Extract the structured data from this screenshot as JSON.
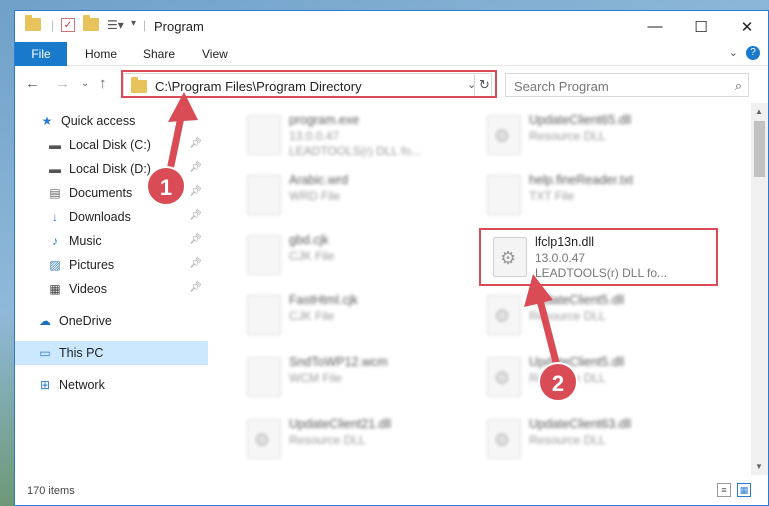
{
  "window": {
    "title": "Program"
  },
  "ribbon": {
    "tabs": [
      {
        "label": "File"
      },
      {
        "label": "Home"
      },
      {
        "label": "Share"
      },
      {
        "label": "View"
      }
    ]
  },
  "address": {
    "path": "C:\\Program Files\\Program Directory"
  },
  "search": {
    "placeholder": "Search Program"
  },
  "nav": {
    "items": [
      {
        "label": "Quick access",
        "icon": "star-icon"
      },
      {
        "label": "Local Disk (C:)",
        "icon": "drive-icon",
        "pinned": true
      },
      {
        "label": "Local Disk (D:)",
        "icon": "drive-icon",
        "pinned": true
      },
      {
        "label": "Documents",
        "icon": "document-icon",
        "pinned": true
      },
      {
        "label": "Downloads",
        "icon": "download-arrow-icon",
        "pinned": true
      },
      {
        "label": "Music",
        "icon": "music-note-icon",
        "pinned": true
      },
      {
        "label": "Pictures",
        "icon": "picture-icon",
        "pinned": true
      },
      {
        "label": "Videos",
        "icon": "film-icon",
        "pinned": true
      },
      {
        "label": "OneDrive",
        "icon": "cloud-icon"
      },
      {
        "label": "This PC",
        "icon": "monitor-icon",
        "selected": true
      },
      {
        "label": "Network",
        "icon": "network-icon"
      }
    ]
  },
  "files": [
    {
      "name": "program.exe",
      "line2": "13.0.0.47",
      "line3": "LEADTOOLS(r) DLL fo...",
      "icon": "exe-icon"
    },
    {
      "name": "UpdateClient65.dll",
      "line2": "Resource DLL",
      "line3": "",
      "icon": "dll-icon"
    },
    {
      "name": "Arabic.wrd",
      "line2": "WRD File",
      "line3": "",
      "icon": "blank-file-icon"
    },
    {
      "name": "help.fineReader.txt",
      "line2": "TXT File",
      "line3": "",
      "icon": "blank-file-icon"
    },
    {
      "name": "gbd.cjk",
      "line2": "CJK File",
      "line3": "",
      "icon": "blank-file-icon"
    },
    {
      "name": "lfclp13n.dll",
      "line2": "13.0.0.47",
      "line3": "LEADTOOLS(r) DLL fo...",
      "icon": "dll-gear-icon"
    },
    {
      "name": "FastHtml.cjk",
      "line2": "CJK File",
      "line3": "",
      "icon": "blank-file-icon"
    },
    {
      "name": "UpdateClient5.dll",
      "line2": "Resource DLL",
      "line3": "",
      "icon": "dll-icon"
    },
    {
      "name": "SndToWP12.wcm",
      "line2": "WCM File",
      "line3": "",
      "icon": "blank-file-icon"
    },
    {
      "name": "UpdateClient5.dll",
      "line2": "Resource DLL",
      "line3": "",
      "icon": "dll-icon"
    },
    {
      "name": "UpdateClient21.dll",
      "line2": "Resource DLL",
      "line3": "",
      "icon": "dll-icon"
    },
    {
      "name": "UpdateClient63.dll",
      "line2": "Resource DLL",
      "line3": "",
      "icon": "dll-icon"
    }
  ],
  "status": {
    "count": "170 items"
  },
  "annotations": {
    "badge1": "1",
    "badge2": "2",
    "color": "#d94b55"
  }
}
